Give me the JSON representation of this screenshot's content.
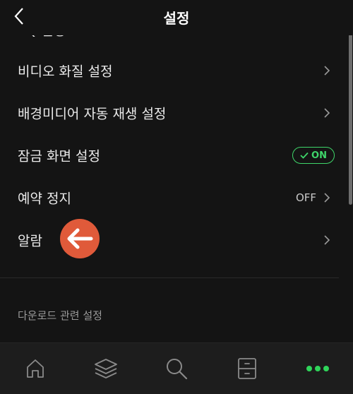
{
  "header": {
    "title": "설정",
    "back_icon": "chevron-left-icon"
  },
  "rows": [
    {
      "label": "EQ 설정",
      "partial": true
    },
    {
      "label": "비디오 화질 설정"
    },
    {
      "label": "배경미디어 자동 재생 설정"
    },
    {
      "label": "잠금 화면 설정",
      "toggle": "ON",
      "toggle_color": "#3fd66a"
    },
    {
      "label": "예약 정지",
      "value": "OFF"
    },
    {
      "label": "알람"
    }
  ],
  "section": {
    "title": "다운로드 관련 설정"
  },
  "annotation": {
    "color": "#e05a3a",
    "icon": "arrow-left-icon"
  },
  "tabbar": {
    "items": [
      {
        "name": "home",
        "icon": "home-icon"
      },
      {
        "name": "library",
        "icon": "layers-icon"
      },
      {
        "name": "search",
        "icon": "search-icon"
      },
      {
        "name": "storage",
        "icon": "cabinet-icon"
      },
      {
        "name": "more",
        "icon": "more-icon",
        "active": true,
        "color": "#2fd55a"
      }
    ]
  }
}
